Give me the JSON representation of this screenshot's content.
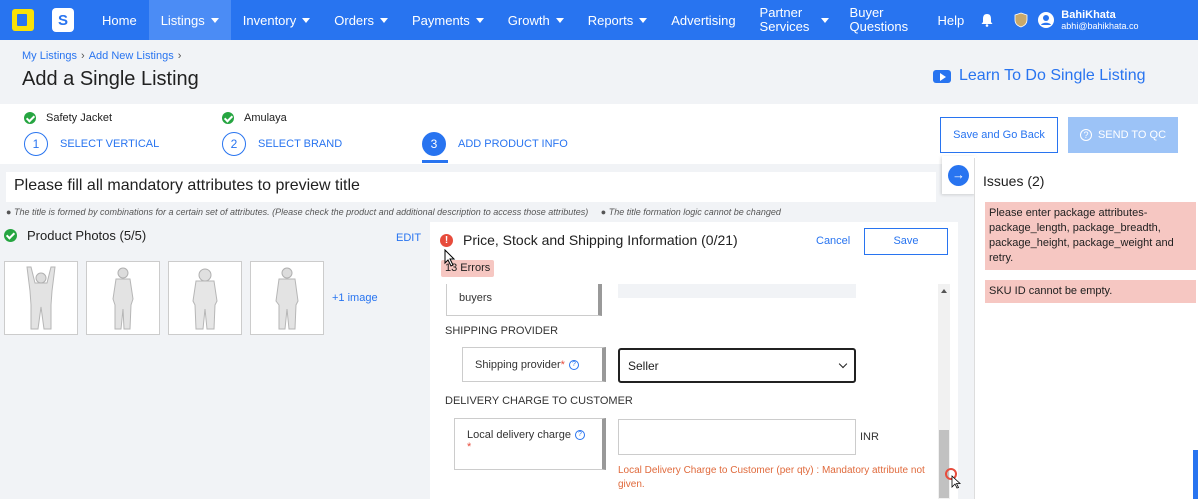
{
  "nav": {
    "items": [
      {
        "label": "Home"
      },
      {
        "label": "Listings"
      },
      {
        "label": "Inventory"
      },
      {
        "label": "Orders"
      },
      {
        "label": "Payments"
      },
      {
        "label": "Growth"
      },
      {
        "label": "Reports"
      },
      {
        "label": "Advertising"
      },
      {
        "label": "Partner Services"
      },
      {
        "label": "Buyer Questions"
      },
      {
        "label": "Help"
      }
    ],
    "user_name": "BahiKhata",
    "user_email": "abhi@bahikhata.co"
  },
  "breadcrumb": {
    "item1": "My Listings",
    "item2": "Add New Listings"
  },
  "page_title": "Add a Single Listing",
  "learn_link": "Learn To Do Single Listing",
  "steps": {
    "done1": "Safety Jacket",
    "done2": "Amulaya",
    "s1_num": "1",
    "s1_label": "SELECT VERTICAL",
    "s2_num": "2",
    "s2_label": "SELECT BRAND",
    "s3_num": "3",
    "s3_label": "ADD PRODUCT INFO"
  },
  "buttons": {
    "save_go_back": "Save and Go Back",
    "send_qc": "SEND TO QC",
    "cancel": "Cancel",
    "save": "Save"
  },
  "title_preview": "Please fill all mandatory attributes to preview title",
  "hints": {
    "h1": "The title is formed by combinations for a certain set of attributes. (Please check the product and additional description to access those attributes)",
    "h2": "The title formation logic cannot be changed"
  },
  "photos": {
    "heading": "Product Photos (5/5)",
    "edit": "EDIT",
    "more": "+1 image"
  },
  "panel": {
    "title": "Price, Stock and Shipping Information (0/21)",
    "errors": "13 Errors",
    "buyers_label": "buyers",
    "shipping_section": "SHIPPING PROVIDER",
    "shipping_label": "Shipping provider",
    "shipping_value": "Seller",
    "delivery_section": "DELIVERY CHARGE TO CUSTOMER",
    "local_label": "Local delivery charge",
    "unit": "INR",
    "local_error": "Local Delivery Charge to Customer (per qty) : Mandatory attribute not given."
  },
  "issues": {
    "heading": "Issues (2)",
    "items": [
      {
        "text": "Please enter package attributes-package_length, package_breadth, package_height, package_weight and retry."
      },
      {
        "text": "SKU ID cannot be empty."
      }
    ]
  },
  "colors": {
    "brand": "#2874f0",
    "error_bg": "#f6c7c2",
    "success": "#26a541"
  }
}
